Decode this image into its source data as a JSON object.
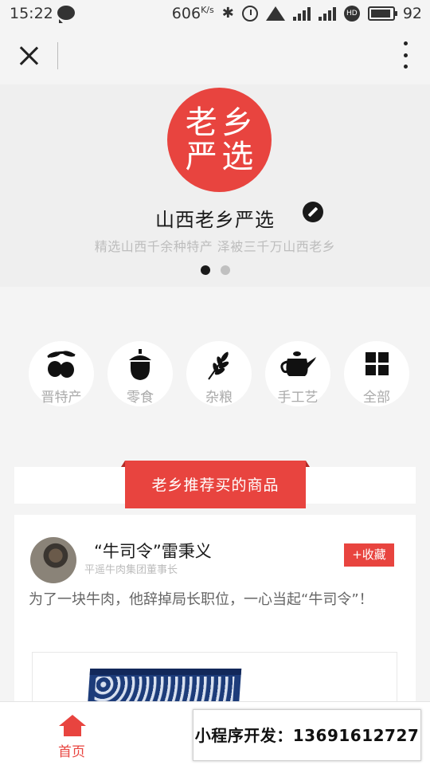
{
  "status_bar": {
    "time": "15:22",
    "speed_value": "606",
    "speed_unit": "K/s",
    "battery": "92",
    "network": "4G",
    "hd": "HD"
  },
  "store": {
    "logo_chars": [
      "老",
      "乡",
      "严",
      "选"
    ],
    "name": "山西老乡严选",
    "slogan": "精选山西千余种特产 泽被三千万山西老乡"
  },
  "categories": [
    {
      "label": "晋特产",
      "icon": "olive-icon"
    },
    {
      "label": "零食",
      "icon": "acorn-icon"
    },
    {
      "label": "杂粮",
      "icon": "wheat-icon"
    },
    {
      "label": "手工艺",
      "icon": "teapot-icon"
    },
    {
      "label": "全部",
      "icon": "grid-icon"
    }
  ],
  "section": {
    "title": "老乡推荐买的商品"
  },
  "product": {
    "person_name": "“牛司令”雷秉义",
    "person_title": "平遥牛肉集团董事长",
    "favorite_label": "+收藏",
    "description": "为了一块牛肉，他辞掉局长职位，一心当起“牛司令”！"
  },
  "tab_bar": {
    "home_label": "首页"
  },
  "contact_banner": {
    "text": "小程序开发：13691612727"
  },
  "colors": {
    "brand_red": "#e8443f",
    "background": "#f4f4f4"
  }
}
